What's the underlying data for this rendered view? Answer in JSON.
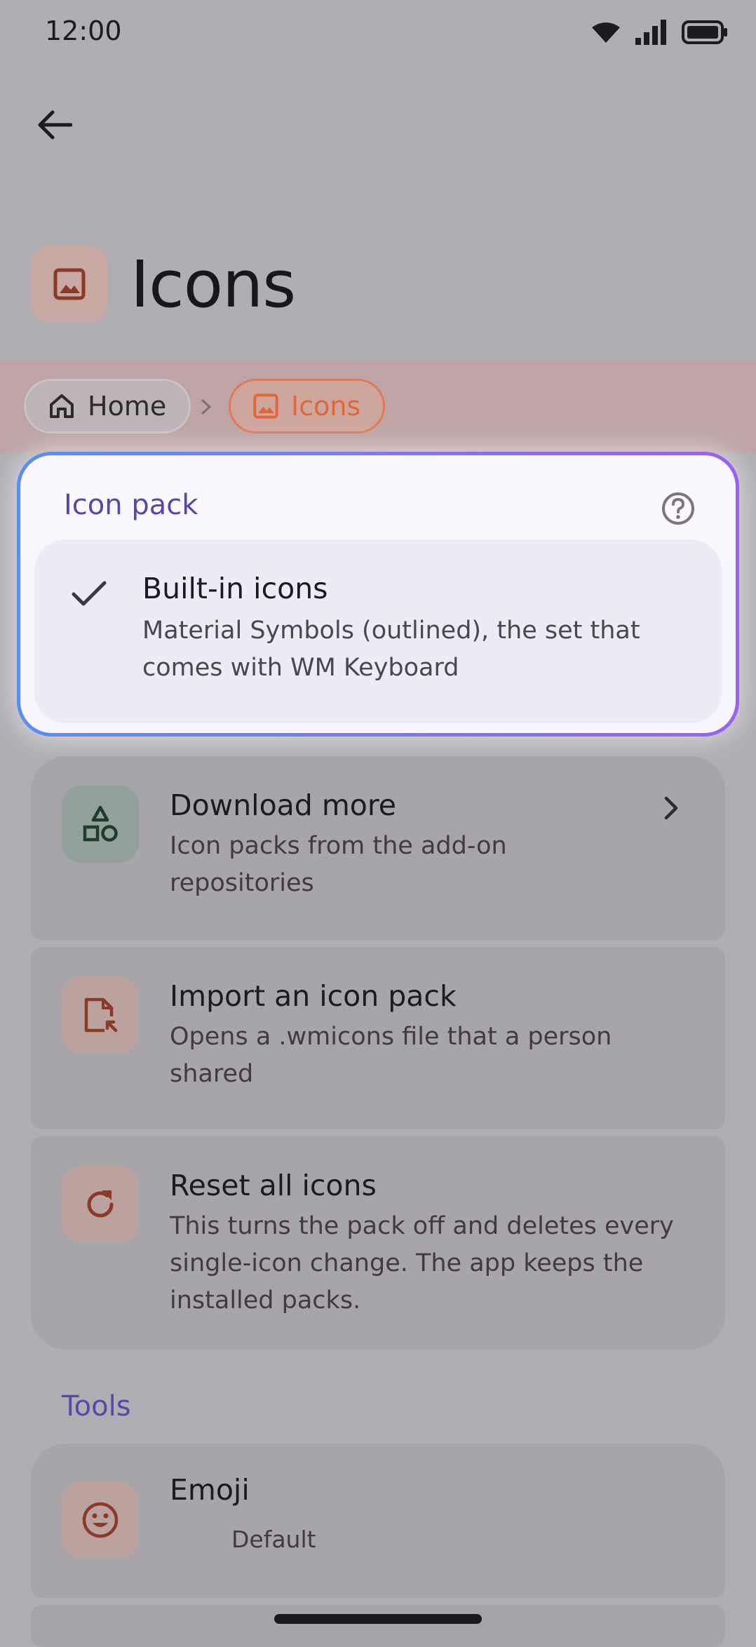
{
  "status_bar": {
    "time": "12:00"
  },
  "header": {
    "title": "Icons"
  },
  "breadcrumb": {
    "home": "Home",
    "current": "Icons"
  },
  "icon_pack": {
    "section_label": "Icon pack",
    "selected": {
      "title": "Built-in icons",
      "description": "Material Symbols (outlined), the set that comes with WM Keyboard"
    }
  },
  "menu": {
    "download": {
      "title": "Download more",
      "description": "Icon packs from the add-on repositories"
    },
    "import": {
      "title": "Import an icon pack",
      "description": "Opens a .wmicons file that a person shared"
    },
    "reset": {
      "title": "Reset all icons",
      "description": "This turns the pack off and deletes every single-icon change. The app keeps the installed packs."
    }
  },
  "tools": {
    "section_label": "Tools",
    "emoji": {
      "title": "Emoji",
      "value": "Default"
    }
  },
  "colors": {
    "accent": "#5847a6",
    "brand": "#e0673c",
    "highlight_border_start": "#5b8ef2",
    "highlight_border_end": "#9b62ee"
  }
}
